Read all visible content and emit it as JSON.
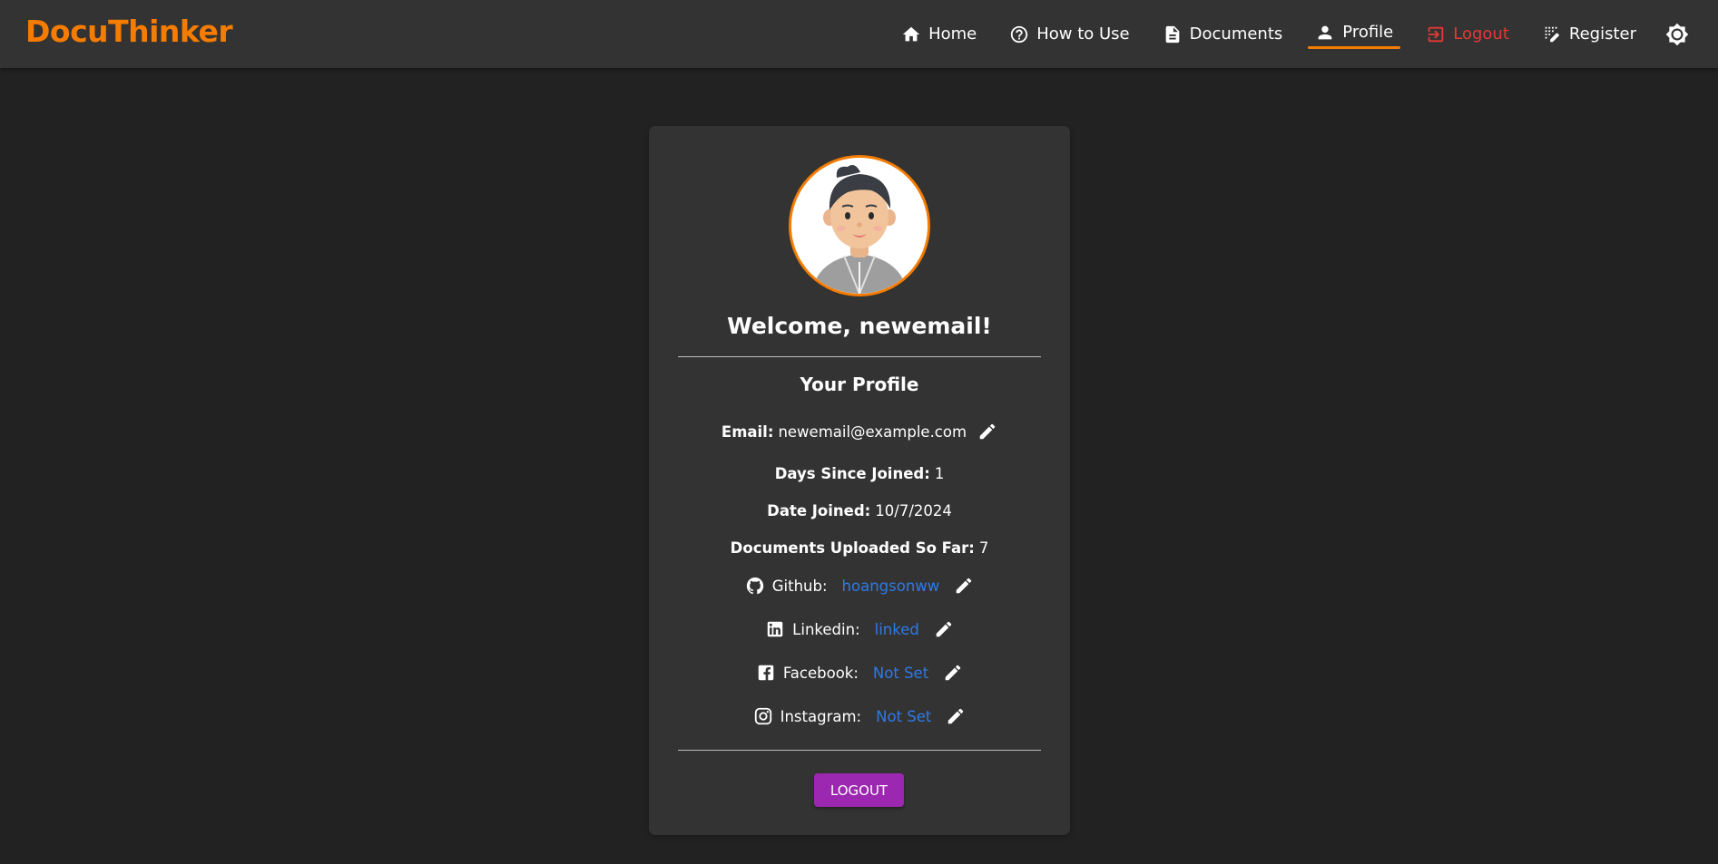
{
  "app": {
    "brand": "DocuThinker"
  },
  "nav": {
    "home": "Home",
    "how_to_use": "How to Use",
    "documents": "Documents",
    "profile": "Profile",
    "logout": "Logout",
    "register": "Register"
  },
  "colors": {
    "accent": "#f57c00",
    "danger": "#e53935",
    "link": "#2f7ae5",
    "button": "#9c27b0",
    "background": "#222222",
    "surface": "#333333"
  },
  "icons": {
    "home": "home-icon",
    "how_to_use": "help-circle-icon",
    "documents": "document-icon",
    "profile": "person-icon",
    "logout": "logout-icon",
    "register": "register-icon",
    "theme": "brightness-icon",
    "edit": "pencil-icon",
    "github": "github-icon",
    "linkedin": "linkedin-icon",
    "facebook": "facebook-icon",
    "instagram": "instagram-icon"
  },
  "profile": {
    "welcome": "Welcome, newemail!",
    "section_title": "Your Profile",
    "email_label": "Email:",
    "email": "newemail@example.com",
    "days_label": "Days Since Joined:",
    "days": "1",
    "date_label": "Date Joined:",
    "date": "10/7/2024",
    "docs_label": "Documents Uploaded So Far:",
    "docs": "7",
    "socials": [
      {
        "label": "Github:",
        "value": "hoangsonww"
      },
      {
        "label": "Linkedin:",
        "value": "linked"
      },
      {
        "label": "Facebook:",
        "value": "Not Set"
      },
      {
        "label": "Instagram:",
        "value": "Not Set"
      }
    ],
    "logout_button": "LOGOUT"
  }
}
